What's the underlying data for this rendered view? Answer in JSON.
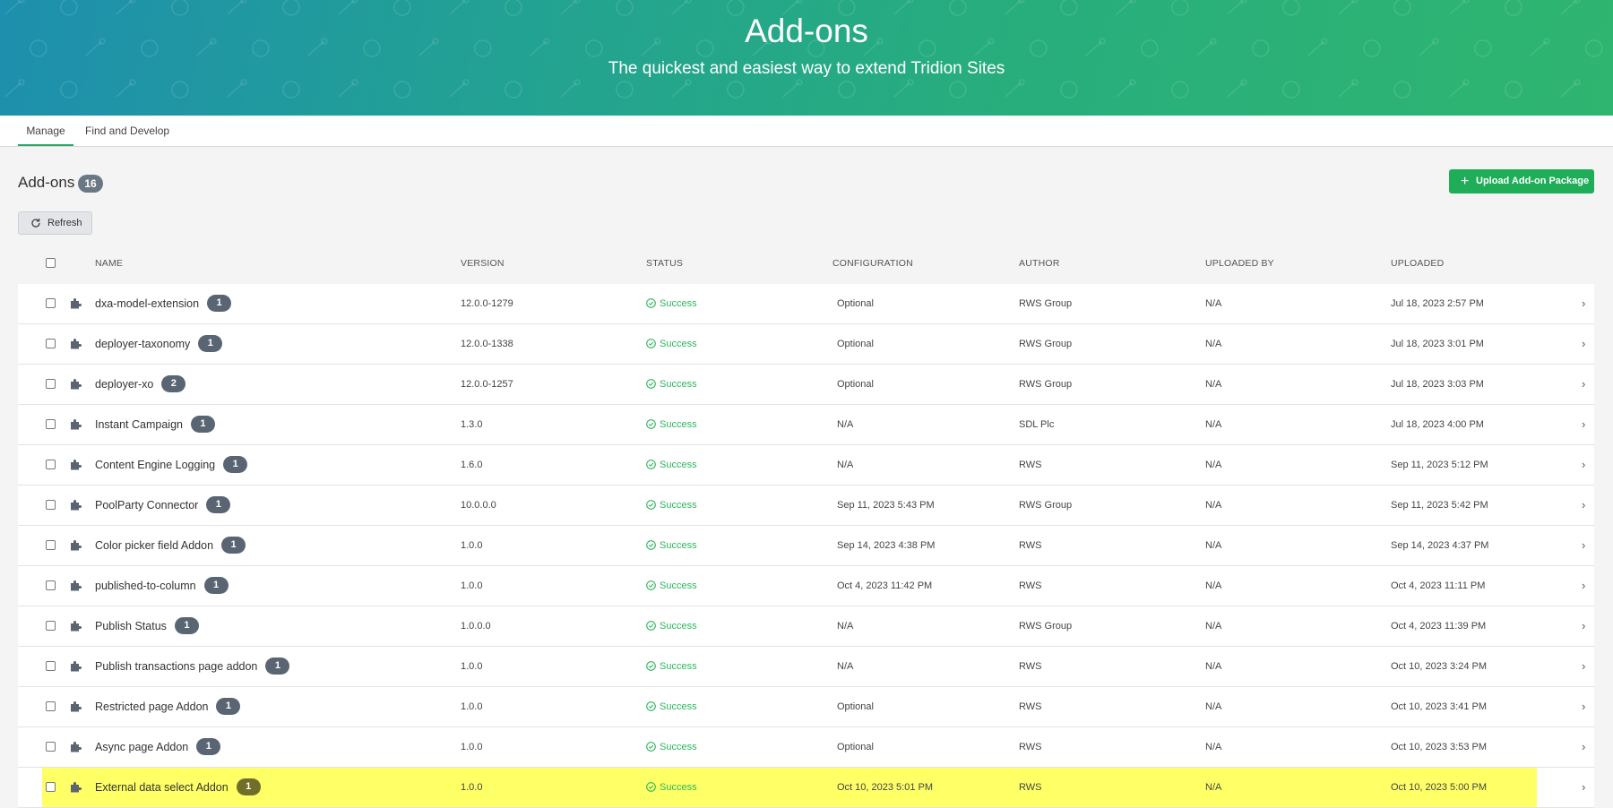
{
  "hero": {
    "title": "Add-ons",
    "subtitle": "The quickest and easiest way to extend Tridion Sites"
  },
  "tabs": [
    {
      "label": "Manage",
      "active": true
    },
    {
      "label": "Find and Develop",
      "active": false
    }
  ],
  "section": {
    "title": "Add-ons",
    "count": "16",
    "upload_label": "Upload Add-on Package",
    "refresh_label": "Refresh"
  },
  "table": {
    "headers": [
      "NAME",
      "VERSION",
      "STATUS",
      "CONFIGURATION",
      "AUTHOR",
      "UPLOADED BY",
      "UPLOADED"
    ],
    "rows": [
      {
        "name": "dxa-model-extension",
        "badge": "1",
        "version": "12.0.0-1279",
        "status": "Success",
        "configuration": "Optional",
        "author": "RWS Group",
        "uploaded_by": "N/A",
        "uploaded": "Jul 18, 2023 2:57 PM"
      },
      {
        "name": "deployer-taxonomy",
        "badge": "1",
        "version": "12.0.0-1338",
        "status": "Success",
        "configuration": "Optional",
        "author": "RWS Group",
        "uploaded_by": "N/A",
        "uploaded": "Jul 18, 2023 3:01 PM"
      },
      {
        "name": "deployer-xo",
        "badge": "2",
        "version": "12.0.0-1257",
        "status": "Success",
        "configuration": "Optional",
        "author": "RWS Group",
        "uploaded_by": "N/A",
        "uploaded": "Jul 18, 2023 3:03 PM"
      },
      {
        "name": "Instant Campaign",
        "badge": "1",
        "version": "1.3.0",
        "status": "Success",
        "configuration": "N/A",
        "author": "SDL Plc",
        "uploaded_by": "N/A",
        "uploaded": "Jul 18, 2023 4:00 PM"
      },
      {
        "name": "Content Engine Logging",
        "badge": "1",
        "version": "1.6.0",
        "status": "Success",
        "configuration": "N/A",
        "author": "RWS",
        "uploaded_by": "N/A",
        "uploaded": "Sep 11, 2023 5:12 PM"
      },
      {
        "name": "PoolParty Connector",
        "badge": "1",
        "version": "10.0.0.0",
        "status": "Success",
        "configuration": "Sep 11, 2023 5:43 PM",
        "author": "RWS Group",
        "uploaded_by": "N/A",
        "uploaded": "Sep 11, 2023 5:42 PM"
      },
      {
        "name": "Color picker field Addon",
        "badge": "1",
        "version": "1.0.0",
        "status": "Success",
        "configuration": "Sep 14, 2023 4:38 PM",
        "author": "RWS",
        "uploaded_by": "N/A",
        "uploaded": "Sep 14, 2023 4:37 PM"
      },
      {
        "name": "published-to-column",
        "badge": "1",
        "version": "1.0.0",
        "status": "Success",
        "configuration": "Oct 4, 2023 11:42 PM",
        "author": "RWS",
        "uploaded_by": "N/A",
        "uploaded": "Oct 4, 2023 11:11 PM"
      },
      {
        "name": "Publish Status",
        "badge": "1",
        "version": "1.0.0.0",
        "status": "Success",
        "configuration": "N/A",
        "author": "RWS Group",
        "uploaded_by": "N/A",
        "uploaded": "Oct 4, 2023 11:39 PM"
      },
      {
        "name": "Publish transactions page addon",
        "badge": "1",
        "version": "1.0.0",
        "status": "Success",
        "configuration": "N/A",
        "author": "RWS",
        "uploaded_by": "N/A",
        "uploaded": "Oct 10, 2023 3:24 PM"
      },
      {
        "name": "Restricted page Addon",
        "badge": "1",
        "version": "1.0.0",
        "status": "Success",
        "configuration": "Optional",
        "author": "RWS",
        "uploaded_by": "N/A",
        "uploaded": "Oct 10, 2023 3:41 PM"
      },
      {
        "name": "Async page Addon",
        "badge": "1",
        "version": "1.0.0",
        "status": "Success",
        "configuration": "Optional",
        "author": "RWS",
        "uploaded_by": "N/A",
        "uploaded": "Oct 10, 2023 3:53 PM"
      },
      {
        "name": "External data select Addon",
        "badge": "1",
        "version": "1.0.0",
        "status": "Success",
        "configuration": "Oct 10, 2023 5:01 PM",
        "author": "RWS",
        "uploaded_by": "N/A",
        "uploaded": "Oct 10, 2023 5:00 PM",
        "highlighted": true
      }
    ]
  },
  "icons": {
    "row_icon": "puzzle-piece-icon",
    "status_icon": "check-circle-icon",
    "row_arrow": "chevron-right-icon",
    "refresh_icon": "refresh-icon",
    "upload_icon": "plus-icon"
  },
  "colors": {
    "accent": "#1fad58",
    "success": "#2bb65b",
    "badge": "#5a6574",
    "highlight": "#ffff66",
    "hero_start": "#1e8fae",
    "hero_end": "#2fb56f"
  }
}
